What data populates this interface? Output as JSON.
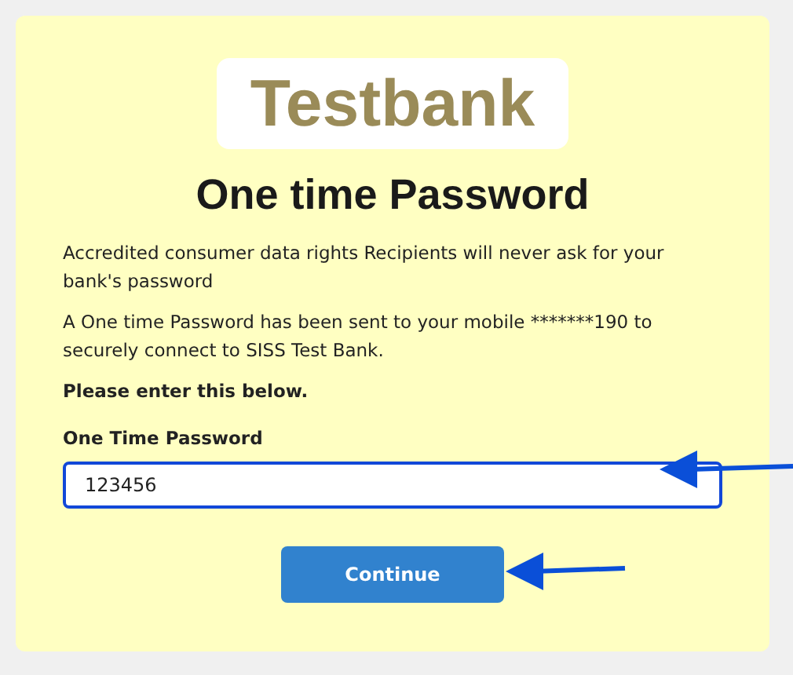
{
  "logo": {
    "text": "Testbank"
  },
  "title": "One time Password",
  "paragraphs": [
    "Accredited consumer data rights Recipients will never ask for your bank's password",
    "A One time Password has been sent to your mobile *******190 to securely connect to SISS Test Bank."
  ],
  "instruction": "Please enter this below.",
  "field": {
    "label": "One Time Password",
    "value": "123456"
  },
  "button": "Continue"
}
